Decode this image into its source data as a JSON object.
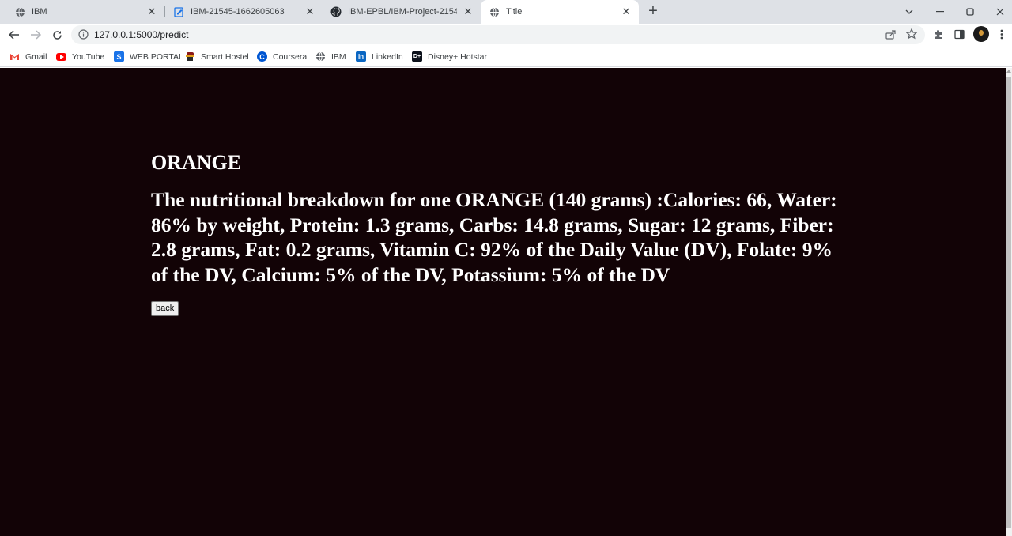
{
  "browser": {
    "tabs": [
      {
        "title": "IBM",
        "icon": "globe-icon"
      },
      {
        "title": "IBM-21545-1662605063",
        "icon": "edit-doc-icon"
      },
      {
        "title": "IBM-EPBL/IBM-Project-21545-16",
        "icon": "github-icon"
      },
      {
        "title": "Title",
        "icon": "globe-icon",
        "active": true
      }
    ],
    "url": "127.0.0.1:5000/predict",
    "bookmarks": [
      {
        "label": "Gmail",
        "icon": "gmail-icon",
        "color": "#ea4335"
      },
      {
        "label": "YouTube",
        "icon": "youtube-icon",
        "color": "#ff0000"
      },
      {
        "label": "WEB PORTAL",
        "icon": "web-portal-icon",
        "color": "#1a73e8"
      },
      {
        "label": "Smart Hostel",
        "icon": "smart-hostel-icon",
        "color": "#8b1a1a"
      },
      {
        "label": "Coursera",
        "icon": "coursera-icon",
        "color": "#0056d2"
      },
      {
        "label": "IBM",
        "icon": "globe-icon",
        "color": "#5f6368"
      },
      {
        "label": "LinkedIn",
        "icon": "linkedin-icon",
        "color": "#0a66c2"
      },
      {
        "label": "Disney+ Hotstar",
        "icon": "hotstar-icon",
        "color": "#0c111b"
      }
    ]
  },
  "page": {
    "background": "#120306",
    "fruit_name": "ORANGE",
    "nutrition_text": "The nutritional breakdown for one ORANGE (140 grams) :Calories: 66, Water: 86% by weight, Protein: 1.3 grams, Carbs: 14.8 grams, Sugar: 12 grams, Fiber: 2.8 grams, Fat: 0.2 grams, Vitamin C: 92% of the Daily Value (DV), Folate: 9% of the DV, Calcium: 5% of the DV, Potassium: 5% of the DV",
    "back_label": "back"
  }
}
